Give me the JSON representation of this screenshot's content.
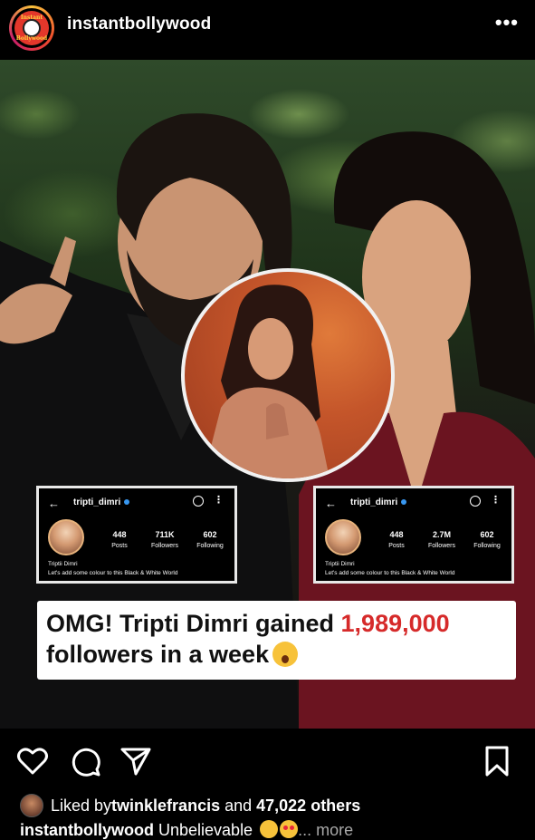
{
  "header": {
    "username": "instantbollywood",
    "avatar_text_top": "Instant",
    "avatar_text_bottom": "Bollywood",
    "more_label": "•••"
  },
  "post": {
    "cards": [
      {
        "back": "←",
        "handle": "tripti_dimri",
        "menu": "⋮",
        "posts": "448",
        "posts_label": "Posts",
        "followers": "711K",
        "followers_label": "Followers",
        "following": "602",
        "following_label": "Following",
        "full_name": "Triptii Dimri",
        "bio": "Let's add some colour to this Black & White World"
      },
      {
        "back": "←",
        "handle": "tripti_dimri",
        "menu": "⋮",
        "posts": "448",
        "posts_label": "Posts",
        "followers": "2.7M",
        "followers_label": "Followers",
        "following": "602",
        "following_label": "Following",
        "full_name": "Triptii Dimri",
        "bio": "Let's add some colour to this Black & White World"
      }
    ],
    "headline": {
      "part1": "OMG! Tripti Dimri gained ",
      "highlight": "1,989,000",
      "line2": "followers in a week"
    }
  },
  "likes": {
    "prefix": "Liked by ",
    "user": "twinklefrancis",
    "middle": " and ",
    "count": "47,022 others"
  },
  "caption": {
    "username": "instantbollywood",
    "text": " Unbelievable ",
    "more": "... more"
  },
  "colors": {
    "highlight_red": "#d62a2a",
    "verified_blue": "#3897f0"
  }
}
